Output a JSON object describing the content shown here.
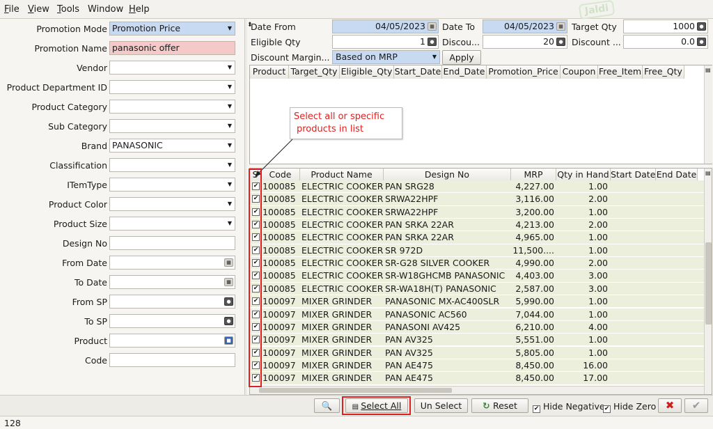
{
  "menu": [
    {
      "pre": "",
      "u": "F",
      "post": "ile"
    },
    {
      "pre": "",
      "u": "V",
      "post": "iew"
    },
    {
      "pre": "",
      "u": "T",
      "post": "ools"
    },
    {
      "pre": "",
      "u": "",
      "post": "Window"
    },
    {
      "pre": "",
      "u": "H",
      "post": "elp"
    }
  ],
  "logo_text": "Jaldi",
  "filters": [
    {
      "label": "Promotion Mode",
      "value": "Promotion Price",
      "control": "dropdown",
      "style": "blue"
    },
    {
      "label": "Promotion Name",
      "value": "panasonic offer",
      "control": "text",
      "style": "pink"
    },
    {
      "label": "Vendor",
      "value": "",
      "control": "dropdown",
      "style": ""
    },
    {
      "label": "Product Department ID",
      "value": "",
      "control": "dropdown",
      "style": ""
    },
    {
      "label": "Product Category",
      "value": "",
      "control": "dropdown",
      "style": ""
    },
    {
      "label": "Sub Category",
      "value": "",
      "control": "dropdown",
      "style": ""
    },
    {
      "label": "Brand",
      "value": "PANASONIC",
      "control": "dropdown",
      "style": ""
    },
    {
      "label": "Classification",
      "value": "",
      "control": "dropdown",
      "style": ""
    },
    {
      "label": "ITemType",
      "value": "",
      "control": "dropdown",
      "style": ""
    },
    {
      "label": "Product Color",
      "value": "",
      "control": "dropdown",
      "style": ""
    },
    {
      "label": "Product Size",
      "value": "",
      "control": "dropdown",
      "style": ""
    },
    {
      "label": "Design No",
      "value": "",
      "control": "text",
      "style": ""
    },
    {
      "label": "From Date",
      "value": "",
      "control": "date",
      "style": ""
    },
    {
      "label": "To Date",
      "value": "",
      "control": "date",
      "style": ""
    },
    {
      "label": "From SP",
      "value": "",
      "control": "spin",
      "style": ""
    },
    {
      "label": "To SP",
      "value": "",
      "control": "spin",
      "style": ""
    },
    {
      "label": "Product",
      "value": "",
      "control": "lookup",
      "style": ""
    },
    {
      "label": "Code",
      "value": "",
      "control": "text",
      "style": ""
    }
  ],
  "promo": {
    "date_from_label": "Date From",
    "date_from": "04/05/2023",
    "date_to_label": "Date To",
    "date_to": "04/05/2023",
    "target_qty_label": "Target Qty",
    "target_qty": "1000",
    "eligible_qty_label": "Eligible Qty",
    "eligible_qty": "1",
    "discount_label": "Discou...",
    "discount": "20",
    "discount2_label": "Discount ...",
    "discount2": "0.0",
    "margin_label": "Discount Margin...",
    "margin_value": "Based on MRP",
    "apply_label": "Apply"
  },
  "promo_table": {
    "columns": [
      "Product",
      "Target_Qty",
      "Eligible_Qty",
      "Start_Date",
      "End_Date",
      "Promotion_Price",
      "Coupon",
      "Free_Item",
      "Free_Qty"
    ]
  },
  "annotation": {
    "line1": "Select all or specific",
    "line2": "products in list"
  },
  "products": {
    "columns": [
      "S",
      "Code",
      "Product Name",
      "Design No",
      "MRP",
      "Qty in Hand",
      "Start Date",
      "End Date"
    ],
    "rows": [
      {
        "code": "100085",
        "name": "ELECTRIC COOKER",
        "design": "PAN SRG28",
        "mrp": "4,227.00",
        "qty": "1.00"
      },
      {
        "code": "100085",
        "name": "ELECTRIC COOKER",
        "design": "SRWA22HPF",
        "mrp": "3,116.00",
        "qty": "2.00"
      },
      {
        "code": "100085",
        "name": "ELECTRIC COOKER",
        "design": "SRWA22HPF",
        "mrp": "3,200.00",
        "qty": "1.00"
      },
      {
        "code": "100085",
        "name": "ELECTRIC COOKER",
        "design": "PAN SRKA 22AR",
        "mrp": "4,213.00",
        "qty": "2.00"
      },
      {
        "code": "100085",
        "name": "ELECTRIC COOKER",
        "design": "PAN SRKA 22AR",
        "mrp": "4,965.00",
        "qty": "1.00"
      },
      {
        "code": "100085",
        "name": "ELECTRIC COOKER",
        "design": "SR 972D",
        "mrp": "11,500....",
        "qty": "1.00"
      },
      {
        "code": "100085",
        "name": "ELECTRIC COOKER",
        "design": "SR-G28 SILVER COOKER",
        "mrp": "4,990.00",
        "qty": "2.00"
      },
      {
        "code": "100085",
        "name": "ELECTRIC COOKER",
        "design": "SR-W18GHCMB PANASONIC",
        "mrp": "4,403.00",
        "qty": "3.00"
      },
      {
        "code": "100085",
        "name": "ELECTRIC COOKER",
        "design": "SR-WA18H(T) PANASONIC",
        "mrp": "2,587.00",
        "qty": "3.00"
      },
      {
        "code": "100097",
        "name": "MIXER GRINDER",
        "design": "PANASONIC MX-AC400SLR",
        "mrp": "5,990.00",
        "qty": "1.00"
      },
      {
        "code": "100097",
        "name": "MIXER GRINDER",
        "design": "PANASONIC AC560",
        "mrp": "7,044.00",
        "qty": "1.00"
      },
      {
        "code": "100097",
        "name": "MIXER GRINDER",
        "design": "PANASONI AV425",
        "mrp": "6,210.00",
        "qty": "4.00"
      },
      {
        "code": "100097",
        "name": "MIXER GRINDER",
        "design": "PAN AV325",
        "mrp": "5,551.00",
        "qty": "1.00"
      },
      {
        "code": "100097",
        "name": "MIXER GRINDER",
        "design": "PAN AV325",
        "mrp": "5,805.00",
        "qty": "1.00"
      },
      {
        "code": "100097",
        "name": "MIXER GRINDER",
        "design": "PAN AE475",
        "mrp": "8,450.00",
        "qty": "16.00"
      },
      {
        "code": "100097",
        "name": "MIXER GRINDER",
        "design": "PAN AE475",
        "mrp": "8,450.00",
        "qty": "17.00"
      }
    ]
  },
  "toolbar": {
    "select_all": "Select All",
    "un_select": "Un Select",
    "reset": "Reset",
    "hide_negative": "Hide Negative",
    "hide_zero": "Hide Zero"
  },
  "status": {
    "count": "128"
  },
  "colors": {
    "accent_red": "#e02020",
    "row_bg": "#ebefdc",
    "highlight_blue": "#c8daf2",
    "highlight_pink": "#f6c9c9"
  }
}
